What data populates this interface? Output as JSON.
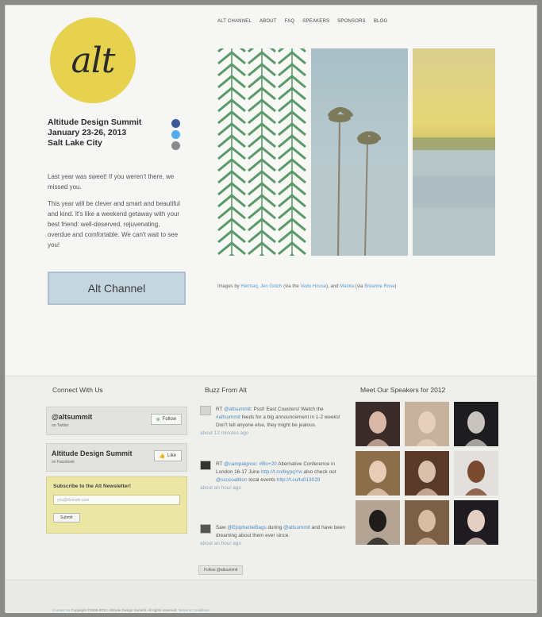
{
  "site": {
    "logo_text": "alt",
    "event_name": "Altitude Design Summit",
    "event_dates": "January 23-26, 2013",
    "event_city": "Salt Lake City",
    "social_icons": [
      "facebook-icon",
      "twitter-icon",
      "youtube-icon"
    ]
  },
  "nav": [
    "ALT CHANNEL",
    "ABOUT",
    "FAQ",
    "SPEAKERS",
    "SPONSORS",
    "BLOG"
  ],
  "intro": {
    "p1": "Last year was sweet! If you weren't there, we missed you.",
    "p2": "This year will be clever and smart and beautiful and kind. It's like a weekend getaway with your best friend: well-deserved, rejuvenating, overdue and comfortable. We can't wait to see you!"
  },
  "alt_channel_button": "Alt Channel",
  "credits": {
    "prefix": "Images by",
    "link1": "Hermaq",
    "sep1": ",",
    "link2": "Jen Gotch",
    "via1": "(via the",
    "link3": "Vedo House",
    "and": "), and",
    "link4": "Malota",
    "via2": "(via",
    "link5": "Breanne Rose",
    "end": ")"
  },
  "connect": {
    "title": "Connect With Us",
    "twitter": {
      "name": "@altsummit",
      "sub": "on Twitter",
      "button": "Follow"
    },
    "facebook": {
      "name": "Altitude Design Summit",
      "sub": "on Facebook",
      "button": "Like"
    },
    "newsletter": {
      "title": "Subscribe to the Alt Newsletter!",
      "placeholder": "you@domain.com",
      "button": "Submit"
    }
  },
  "buzz": {
    "title": "Buzz From Alt",
    "tweets": [
      {
        "prefix": "RT",
        "handle": "@altsummit",
        "text1": ": Psst! East Coasters! Watch the",
        "hashtag": "#altsummit",
        "text2": "feeds for a big announcement in 1-2 weeks! Don't tell anyone else, they might be jealous.",
        "time": "about 12 minutes ago"
      },
      {
        "prefix": "RT",
        "handle": "@campaignoc",
        "text1": ":",
        "hashtag": "#Bo+20",
        "text2": "Alternative Conference in London 16-17 June",
        "link": "http://t.co/lkypqYw",
        "text3": "also check out",
        "handle2": "@scccoalition",
        "text4": "local events",
        "link2": "http://t.co/lu013029",
        "time": "about an hour ago"
      },
      {
        "prefix": "Saw",
        "handle": "@EpiphanieBags",
        "text1": "during",
        "handle2": "@altsummit",
        "text2": "and have been dreaming about them ever since.",
        "time": "about an hour ago"
      }
    ],
    "follow_button": "Follow @altsummit"
  },
  "speakers": {
    "title": "Meet Our Speakers for 2012",
    "count": 9
  },
  "footer": {
    "prefix": "Contact Us",
    "text": "Copyright ©2009-2012, Altitude Design Summit. All rights reserved.",
    "link": "Terms & Conditions"
  },
  "colors": {
    "logo_yellow": "#e6d24e",
    "button_blue": "#c6d6e0",
    "link_blue": "#4f8bbf",
    "newsletter_yellow": "#ebe6a4",
    "chevron_green": "#5a9a6a"
  }
}
